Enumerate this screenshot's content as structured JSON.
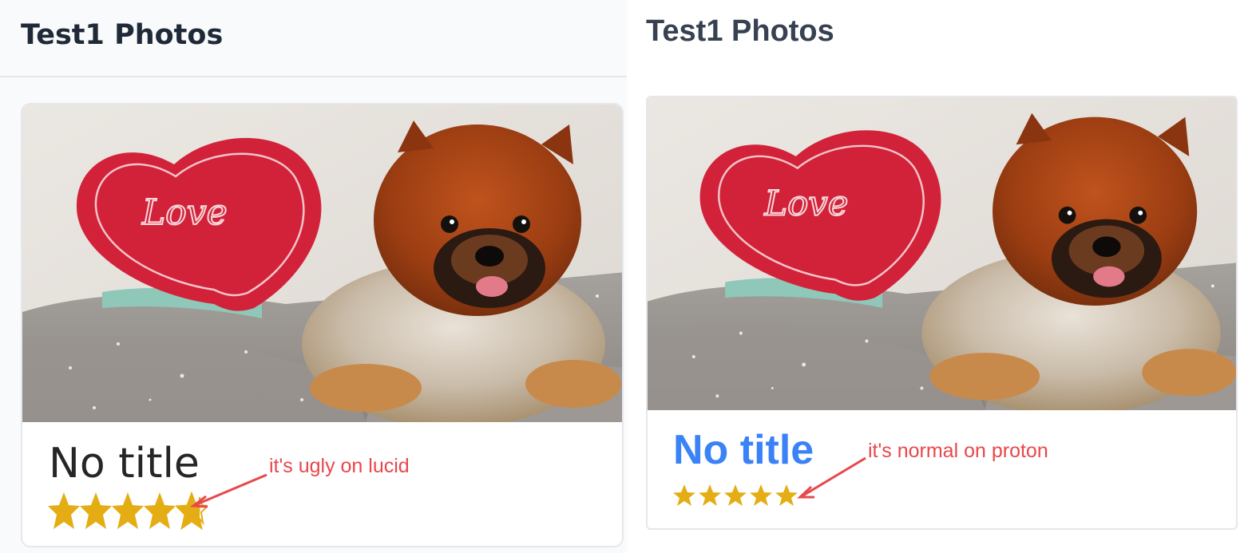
{
  "lucid": {
    "page_title": "Test1 Photos",
    "card": {
      "title": "No title",
      "rating": 5,
      "rating_max": 5
    },
    "annotation": "it's ugly on lucid"
  },
  "proton": {
    "page_title": "Test1 Photos",
    "card": {
      "title": "No title",
      "rating": 5,
      "rating_max": 5
    },
    "annotation": "it's normal on proton"
  },
  "colors": {
    "star": "#e5ad14",
    "proton_title": "#3b82f6",
    "annotation": "#e8474b"
  },
  "icons": {
    "rating_star": "star-icon",
    "annotation_arrow": "arrow-icon",
    "photo": "dog-with-heart-pillow"
  }
}
